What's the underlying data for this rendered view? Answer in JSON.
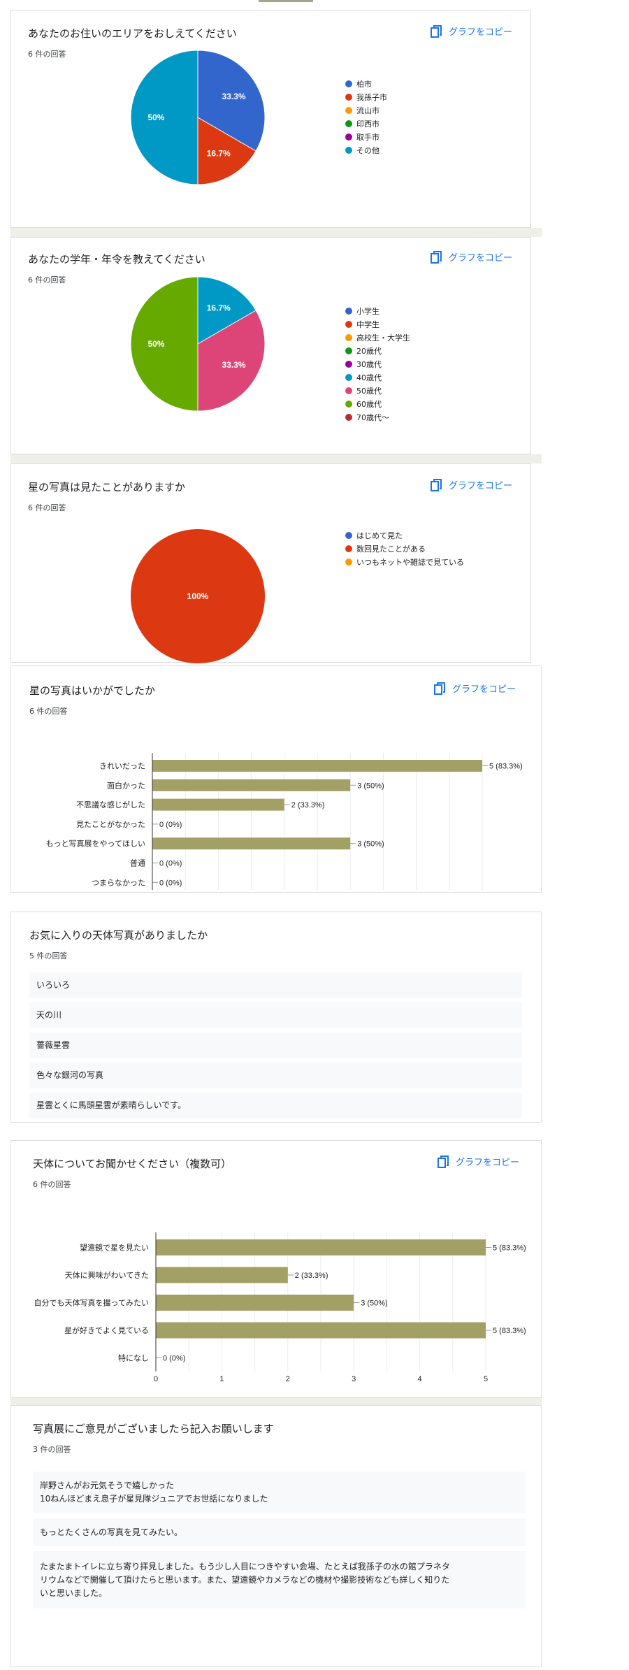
{
  "copy_label": "グラフをコピー",
  "cards": [
    {
      "title": "あなたのお住いのエリアをおしえてください",
      "count": "6 件の回答",
      "legend": [
        {
          "label": "柏市",
          "color": "#3366cc"
        },
        {
          "label": "我孫子市",
          "color": "#dc3912"
        },
        {
          "label": "流山市",
          "color": "#ff9900"
        },
        {
          "label": "印西市",
          "color": "#109618"
        },
        {
          "label": "取手市",
          "color": "#990099"
        },
        {
          "label": "その他",
          "color": "#0099c6"
        }
      ]
    },
    {
      "title": "あなたの学年・年令を教えてください",
      "count": "6 件の回答",
      "legend": [
        {
          "label": "小学生",
          "color": "#3366cc"
        },
        {
          "label": "中学生",
          "color": "#dc3912"
        },
        {
          "label": "高校生・大学生",
          "color": "#ff9900"
        },
        {
          "label": "20歳代",
          "color": "#109618"
        },
        {
          "label": "30歳代",
          "color": "#990099"
        },
        {
          "label": "40歳代",
          "color": "#0099c6"
        },
        {
          "label": "50歳代",
          "color": "#dd4477"
        },
        {
          "label": "60歳代",
          "color": "#66aa00"
        },
        {
          "label": "70歳代～",
          "color": "#b82e2e"
        }
      ]
    },
    {
      "title": "星の写真は見たことがありますか",
      "count": "6 件の回答",
      "legend": [
        {
          "label": "はじめて見た",
          "color": "#3366cc"
        },
        {
          "label": "数回見たことがある",
          "color": "#dc3912"
        },
        {
          "label": "いつもネットや雑誌で見ている",
          "color": "#ff9900"
        }
      ]
    },
    {
      "title": "星の写真はいかがでしたか",
      "count": "6 件の回答"
    },
    {
      "title": "お気に入りの天体写真がありましたか",
      "count": "5 件の回答",
      "responses": [
        "いろいろ",
        "天の川",
        "薔薇星雲",
        "色々な銀河の写真",
        "星雲とくに馬頭星雲が素晴らしいです。"
      ]
    },
    {
      "title": "天体についてお聞かせください（複数可）",
      "count": "6 件の回答"
    },
    {
      "title": "写真展にご意見がございましたら記入お願いします",
      "count": "3 件の回答",
      "responses": [
        {
          "lines": [
            "岸野さんがお元気そうで嬉しかった",
            "10ねんほどまえ息子が星見隊ジュニアでお世話になりました"
          ]
        },
        {
          "lines": [
            "もっとたくさんの写真を見てみたい。"
          ]
        },
        {
          "lines": [
            "たまたまトイレに立ち寄り拝見しました。もう少し人目につきやすい会場、たとえば我孫子の水の館プラネタ",
            "リウムなどで開催して頂けたらと思います。また、望遠鏡やカメラなどの機材や撮影技術なども詳しく知りた",
            "いと思いました。"
          ]
        }
      ]
    }
  ],
  "chart_data": [
    {
      "type": "pie",
      "labels": [
        "柏市",
        "我孫子市",
        "流山市",
        "印西市",
        "取手市",
        "その他"
      ],
      "values": [
        2,
        1,
        0,
        0,
        0,
        3
      ],
      "slice_labels": [
        "33.3%",
        "16.7%",
        "",
        "",
        "",
        "50%"
      ],
      "colors": [
        "#3366cc",
        "#dc3912",
        "#ff9900",
        "#109618",
        "#990099",
        "#0099c6"
      ]
    },
    {
      "type": "pie",
      "labels": [
        "小学生",
        "中学生",
        "高校生・大学生",
        "20歳代",
        "30歳代",
        "40歳代",
        "50歳代",
        "60歳代",
        "70歳代～"
      ],
      "values": [
        0,
        0,
        0,
        0,
        0,
        1,
        2,
        3,
        0
      ],
      "slice_labels": [
        "",
        "",
        "",
        "",
        "",
        "16.7%",
        "33.3%",
        "50%",
        ""
      ],
      "colors": [
        "#3366cc",
        "#dc3912",
        "#ff9900",
        "#109618",
        "#990099",
        "#0099c6",
        "#dd4477",
        "#66aa00",
        "#b82e2e"
      ]
    },
    {
      "type": "pie",
      "labels": [
        "はじめて見た",
        "数回見たことがある",
        "いつもネットや雑誌で見ている"
      ],
      "values": [
        0,
        6,
        0
      ],
      "slice_labels": [
        "",
        "100%",
        ""
      ],
      "colors": [
        "#3366cc",
        "#dc3912",
        "#ff9900"
      ]
    },
    {
      "type": "bar",
      "orientation": "horizontal",
      "categories": [
        "きれいだった",
        "面白かった",
        "不思議な感じがした",
        "見たことがなかった",
        "もっと写真展をやってほしい",
        "普通",
        "つまらなかった"
      ],
      "values": [
        5,
        3,
        2,
        0,
        3,
        0,
        0
      ],
      "data_labels": [
        "5 (83.3%)",
        "3 (50%)",
        "2 (33.3%)",
        "0 (0%)",
        "3 (50%)",
        "0 (0%)",
        "0 (0%)"
      ],
      "xlim": [
        0,
        5
      ],
      "xticks": [
        "0",
        "1",
        "2",
        "3",
        "4",
        "5"
      ],
      "bar_color": "#a3a066"
    },
    {
      "type": "bar",
      "orientation": "horizontal",
      "categories": [
        "望遠鏡で星を見たい",
        "天体に興味がわいてきた",
        "自分でも天体写真を撮ってみたい",
        "星が好きでよく見ている",
        "特になし"
      ],
      "values": [
        5,
        2,
        3,
        5,
        0
      ],
      "data_labels": [
        "5 (83.3%)",
        "2 (33.3%)",
        "3 (50%)",
        "5 (83.3%)",
        "0 (0%)"
      ],
      "xlim": [
        0,
        5
      ],
      "xticks": [
        "0",
        "1",
        "2",
        "3",
        "4",
        "5"
      ],
      "bar_color": "#a3a066"
    }
  ]
}
